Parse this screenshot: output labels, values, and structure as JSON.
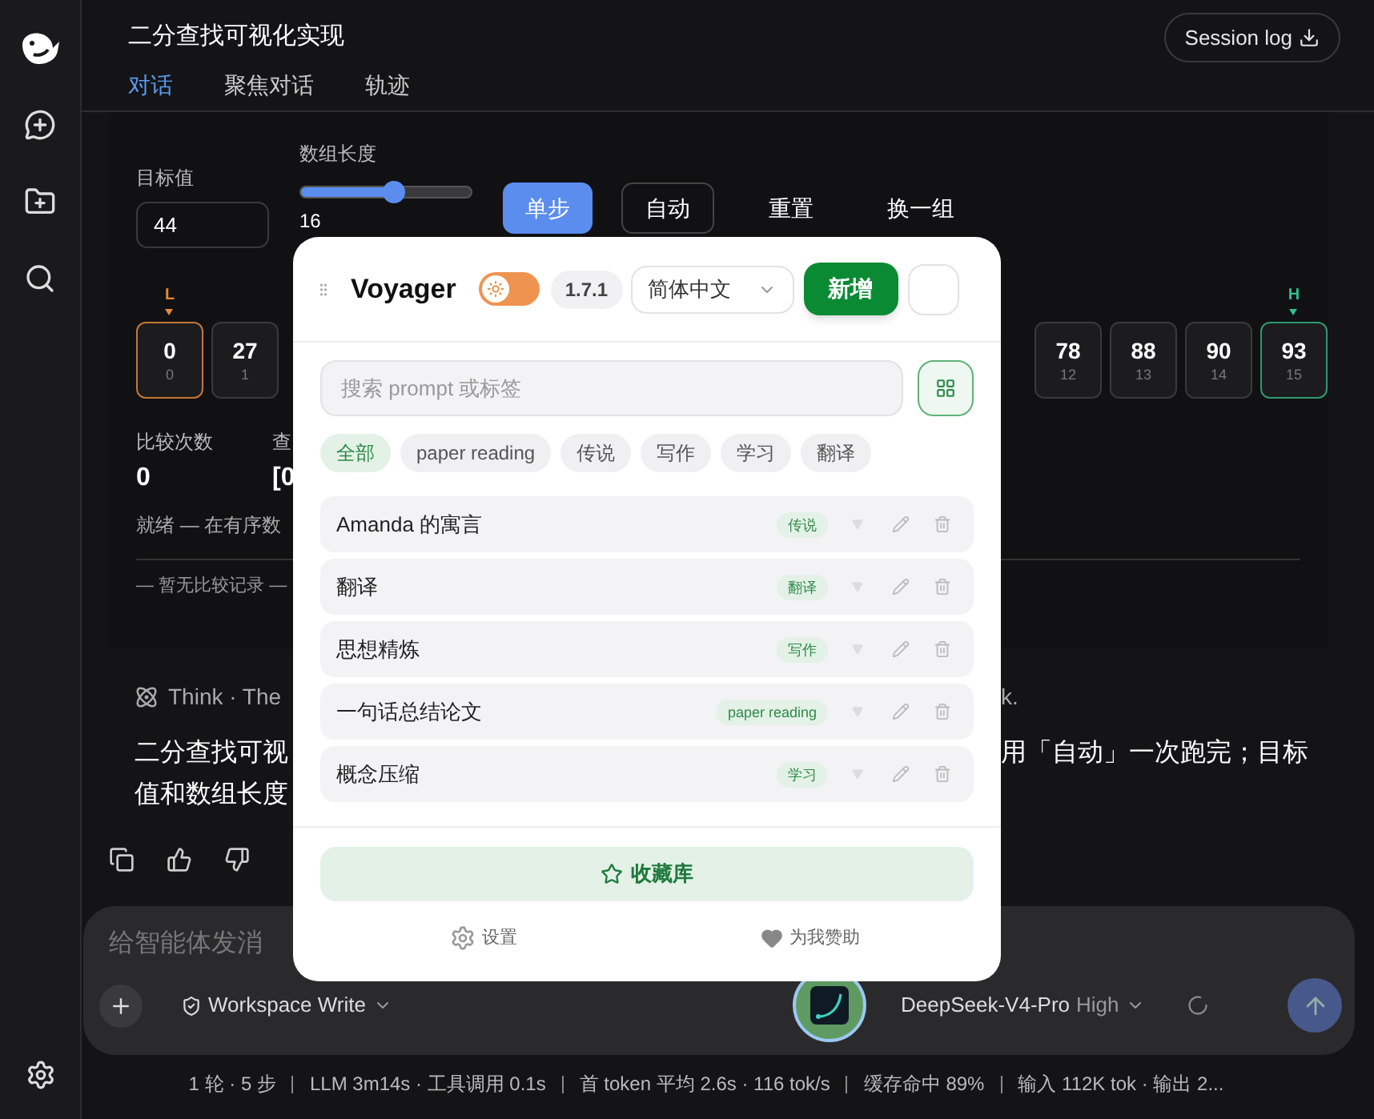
{
  "header": {
    "title": "二分查找可视化实现",
    "session_button": "Session log",
    "tabs": [
      {
        "label": "对话",
        "selected": true
      },
      {
        "label": "聚焦对话",
        "selected": false
      },
      {
        "label": "轨迹",
        "selected": false
      }
    ]
  },
  "visualizer": {
    "target_label": "目标值",
    "target_value": "44",
    "length_label": "数组长度",
    "length_slider": {
      "level": 0.55
    },
    "length_value": "16",
    "buttons": [
      {
        "label": "单步",
        "kind": "primary"
      },
      {
        "label": "自动",
        "kind": "outline"
      },
      {
        "label": "重置",
        "kind": "plain"
      },
      {
        "label": "换一组",
        "kind": "plain"
      }
    ],
    "cells_left": [
      {
        "value": "0",
        "index": "0",
        "marker": {
          "label": "L",
          "kind": "low"
        }
      },
      {
        "value": "27",
        "index": "1"
      }
    ],
    "cells_right": [
      {
        "value": "78",
        "index": "12"
      },
      {
        "value": "88",
        "index": "13"
      },
      {
        "value": "90",
        "index": "14"
      },
      {
        "value": "93",
        "index": "15",
        "marker": {
          "label": "H",
          "kind": "high"
        }
      }
    ],
    "stats": [
      {
        "label": "比较次数",
        "value": "0"
      },
      {
        "label": "查",
        "value": "[0"
      }
    ],
    "status": "就绪 — 在有序数",
    "log_empty": "— 暂无比较记录 —"
  },
  "message": {
    "think_left": "Think · The",
    "think_right": "k.",
    "lines": [
      {
        "left": "二分查找可视",
        "right": "用「自动」一次跑完；目标"
      },
      {
        "left": "值和数组长度"
      }
    ]
  },
  "composer": {
    "placeholder": "给智能体发消",
    "mode": "Workspace Write",
    "model": "DeepSeek-V4-Pro",
    "effort": "High"
  },
  "status_bar": [
    "1 轮 · 5 步",
    "LLM 3m14s · 工具调用 0.1s",
    "首 token 平均 2.6s · 116 tok/s",
    "缓存命中 89%",
    "输入 112K tok · 输出 2..."
  ],
  "voyager": {
    "title": "Voyager",
    "dark_mode_toggle": {
      "on": false
    },
    "version": "1.7.1",
    "language": "简体中文",
    "add_button": "新增",
    "search_placeholder": "搜索 prompt 或标签",
    "filters": [
      {
        "label": "全部",
        "selected": true
      },
      {
        "label": "paper reading",
        "selected": false
      },
      {
        "label": "传说",
        "selected": false
      },
      {
        "label": "写作",
        "selected": false
      },
      {
        "label": "学习",
        "selected": false
      },
      {
        "label": "翻译",
        "selected": false
      }
    ],
    "prompts": [
      {
        "title": "Amanda 的寓言",
        "tag": "传说"
      },
      {
        "title": "翻译",
        "tag": "翻译"
      },
      {
        "title": "思想精炼",
        "tag": "写作"
      },
      {
        "title": "一句话总结论文",
        "tag": "paper reading"
      },
      {
        "title": "概念压缩",
        "tag": "学习"
      }
    ],
    "library_button": "收藏库",
    "footer": [
      {
        "kind": "settings",
        "label": "设置"
      },
      {
        "kind": "sponsor",
        "label": "为我赞助"
      }
    ]
  }
}
